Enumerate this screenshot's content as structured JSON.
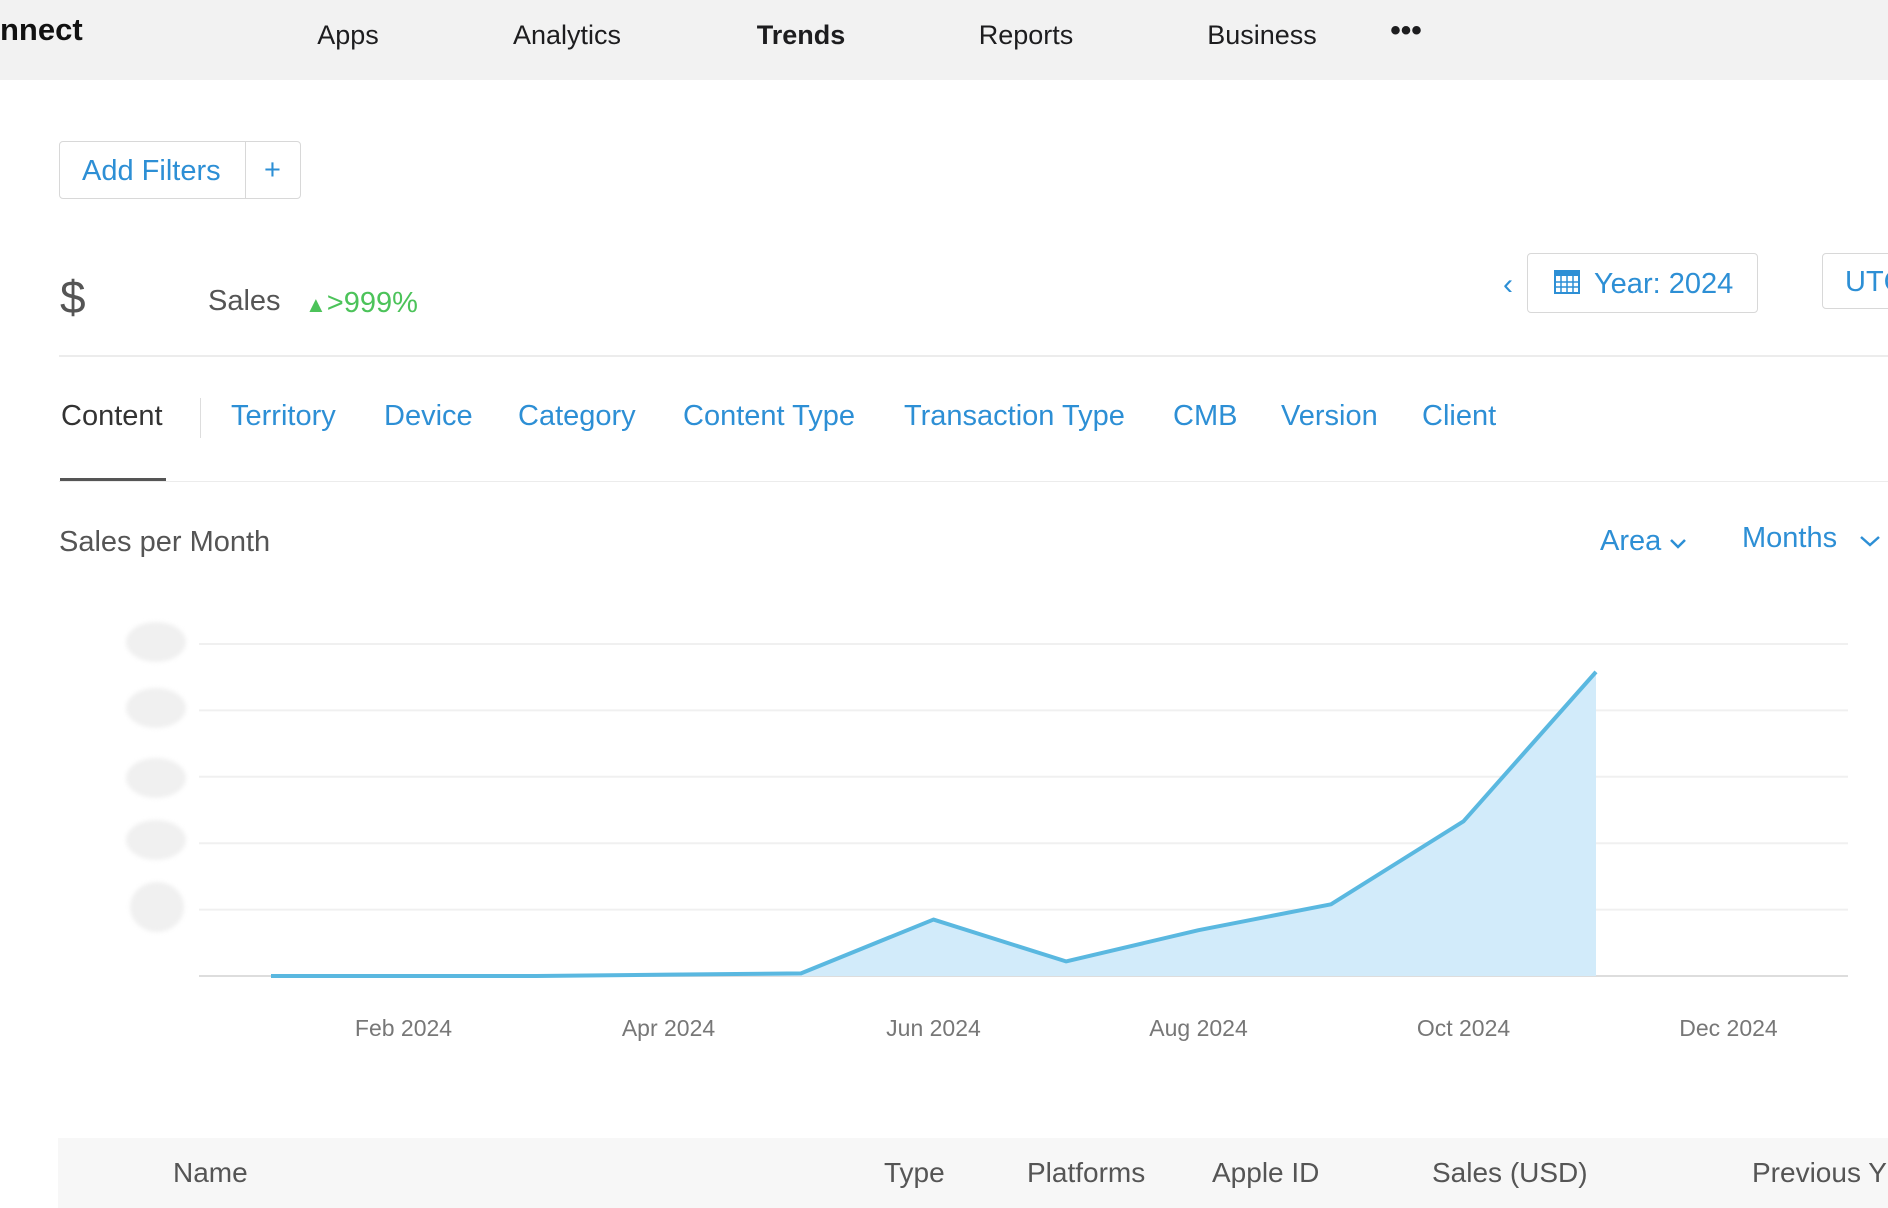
{
  "nav": {
    "brand": "nnect",
    "items": [
      "Apps",
      "Analytics",
      "Trends",
      "Reports",
      "Business"
    ],
    "active": "Trends",
    "more_icon": "ellipsis-icon"
  },
  "filters": {
    "add_label": "Add Filters",
    "plus_label": "+"
  },
  "summary": {
    "currency_symbol": "$",
    "metric": "Sales",
    "change": ">999%",
    "change_color": "#4cc35a",
    "period": "Year: 2024",
    "timezone": "UTC"
  },
  "tabs": [
    "Content",
    "Territory",
    "Device",
    "Category",
    "Content Type",
    "Transaction Type",
    "CMB",
    "Version",
    "Client"
  ],
  "chart_header": {
    "title": "Sales per Month",
    "chart_type_select": "Area",
    "interval_select": "Months"
  },
  "chart_data": {
    "type": "area",
    "title": "Sales per Month",
    "x": [
      "Jan 2024",
      "Feb 2024",
      "Mar 2024",
      "Apr 2024",
      "May 2024",
      "Jun 2024",
      "Jul 2024",
      "Aug 2024",
      "Sep 2024",
      "Oct 2024",
      "Nov 2024"
    ],
    "x_tick_labels": [
      "Feb 2024",
      "Apr 2024",
      "Jun 2024",
      "Aug 2024",
      "Oct 2024",
      "Dec 2024"
    ],
    "values": [
      0,
      0,
      0,
      0.02,
      0.04,
      0.85,
      0.22,
      0.69,
      1.08,
      2.33,
      4.58
    ],
    "y_tick_labels": "redacted",
    "ylim": [
      0,
      5
    ],
    "grid": true,
    "line_color": "#5ab8e0",
    "fill_color": "#d2ebfa"
  },
  "table": {
    "columns": [
      "Name",
      "Type",
      "Platforms",
      "Apple ID",
      "Sales (USD)",
      "Previous Y"
    ]
  }
}
